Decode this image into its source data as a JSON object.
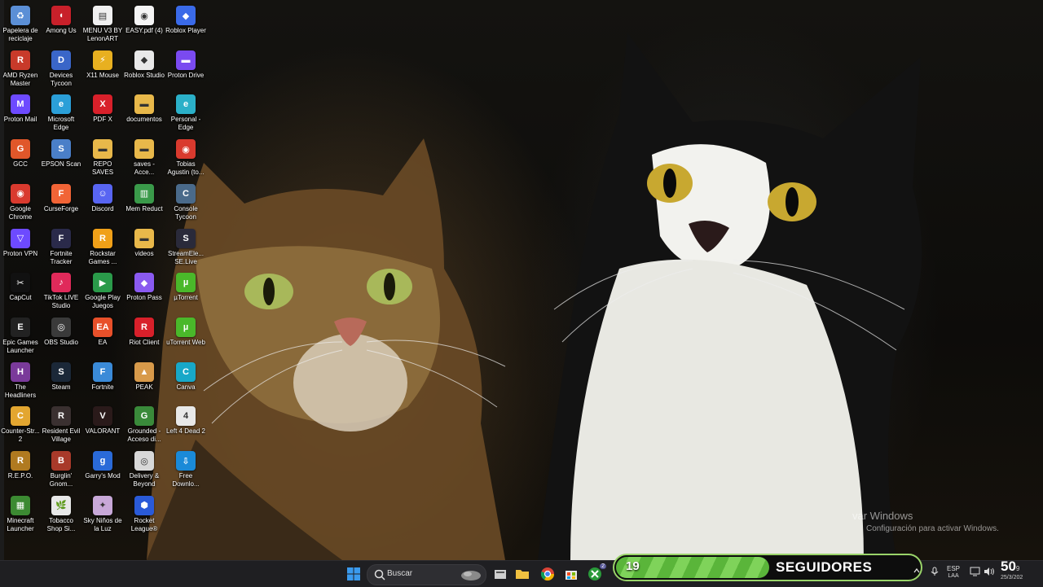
{
  "desktop": {
    "columns": [
      [
        {
          "label": "Papelera de reciclaje",
          "icon": "recycle-bin-icon",
          "color": "#5b8fd6",
          "glyph": "♻"
        },
        {
          "label": "AMD Ryzen Master",
          "icon": "amd-ryzen-icon",
          "color": "#c83a2a",
          "glyph": "R"
        },
        {
          "label": "Proton Mail",
          "icon": "proton-mail-icon",
          "color": "#6d4aff",
          "glyph": "M"
        },
        {
          "label": "GCC",
          "icon": "gcc-icon",
          "color": "#e0572a",
          "glyph": "G"
        },
        {
          "label": "Google Chrome",
          "icon": "chrome-icon",
          "color": "#d93a2e",
          "glyph": "◉"
        },
        {
          "label": "Proton VPN",
          "icon": "proton-vpn-icon",
          "color": "#6d4aff",
          "glyph": "▽"
        },
        {
          "label": "CapCut",
          "icon": "capcut-icon",
          "color": "#111111",
          "glyph": "✂"
        },
        {
          "label": "Epic Games Launcher",
          "icon": "epic-games-icon",
          "color": "#222222",
          "glyph": "E"
        },
        {
          "label": "The Headliners",
          "icon": "headliners-icon",
          "color": "#7a3a9a",
          "glyph": "H"
        },
        {
          "label": "Counter-Str... 2",
          "icon": "counter-strike-icon",
          "color": "#e3a630",
          "glyph": "C"
        },
        {
          "label": "R.E.P.O.",
          "icon": "repo-icon",
          "color": "#b07a20",
          "glyph": "R"
        },
        {
          "label": "Minecraft Launcher",
          "icon": "minecraft-icon",
          "color": "#3c8a32",
          "glyph": "▦"
        }
      ],
      [
        {
          "label": "Among Us",
          "icon": "among-us-icon",
          "color": "#c8202a",
          "glyph": "◖"
        },
        {
          "label": "Devices Tycoon",
          "icon": "devices-tycoon-icon",
          "color": "#3a66c8",
          "glyph": "D"
        },
        {
          "label": "Microsoft Edge",
          "icon": "edge-icon",
          "color": "#2b9fd8",
          "glyph": "e"
        },
        {
          "label": "EPSON Scan",
          "icon": "epson-scan-icon",
          "color": "#4a7fc8",
          "glyph": "S"
        },
        {
          "label": "CurseForge",
          "icon": "curseforge-icon",
          "color": "#f16436",
          "glyph": "F"
        },
        {
          "label": "Fortnite Tracker",
          "icon": "fortnite-tracker-icon",
          "color": "#2a2a4a",
          "glyph": "F"
        },
        {
          "label": "TikTok LIVE Studio",
          "icon": "tiktok-live-icon",
          "color": "#e02a5a",
          "glyph": "♪"
        },
        {
          "label": "OBS Studio",
          "icon": "obs-studio-icon",
          "color": "#3a3a3a",
          "glyph": "◎"
        },
        {
          "label": "Steam",
          "icon": "steam-icon",
          "color": "#1b2838",
          "glyph": "S"
        },
        {
          "label": "Resident Evil Village",
          "icon": "resident-evil-icon",
          "color": "#3a3030",
          "glyph": "R"
        },
        {
          "label": "Burglin' Gnom...",
          "icon": "burglin-gnomes-icon",
          "color": "#a83a2a",
          "glyph": "B"
        },
        {
          "label": "Tobacco Shop Si...",
          "icon": "tobacco-shop-icon",
          "color": "#e8e8e8",
          "glyph": "🌿"
        }
      ],
      [
        {
          "label": "MENU V3 BY LenonART",
          "icon": "menu-file-icon",
          "color": "#f0f0f0",
          "glyph": "▤"
        },
        {
          "label": "X11 Mouse",
          "icon": "x11-mouse-icon",
          "color": "#e8b020",
          "glyph": "⚡"
        },
        {
          "label": "PDF X",
          "icon": "pdf-x-icon",
          "color": "#d8202a",
          "glyph": "X"
        },
        {
          "label": "REPO SAVES",
          "icon": "folder-icon",
          "color": "#e8b84a",
          "glyph": "▬"
        },
        {
          "label": "Discord",
          "icon": "discord-icon",
          "color": "#5865f2",
          "glyph": "☺"
        },
        {
          "label": "Rockstar Games ...",
          "icon": "rockstar-icon",
          "color": "#f0a018",
          "glyph": "R"
        },
        {
          "label": "Google Play Juegos",
          "icon": "google-play-icon",
          "color": "#2a9a4a",
          "glyph": "▶"
        },
        {
          "label": "EA",
          "icon": "ea-icon",
          "color": "#e8502a",
          "glyph": "EA"
        },
        {
          "label": "Fortnite",
          "icon": "fortnite-icon",
          "color": "#3a8ad8",
          "glyph": "F"
        },
        {
          "label": "VALORANT",
          "icon": "valorant-icon",
          "color": "#2a1a1a",
          "glyph": "V"
        },
        {
          "label": "Garry's Mod",
          "icon": "garrys-mod-icon",
          "color": "#2a6ad8",
          "glyph": "g"
        },
        {
          "label": "Sky Niños de la Luz",
          "icon": "sky-icon",
          "color": "#c8a8d8",
          "glyph": "✦"
        }
      ],
      [
        {
          "label": "EASY.pdf (4)",
          "icon": "chrome-pdf-icon",
          "color": "#f4f4f4",
          "glyph": "◉"
        },
        {
          "label": "Roblox Studio",
          "icon": "roblox-studio-icon",
          "color": "#e8e8e8",
          "glyph": "◆"
        },
        {
          "label": "documentos",
          "icon": "folder-icon",
          "color": "#e8b84a",
          "glyph": "▬"
        },
        {
          "label": "saves - Acce...",
          "icon": "folder-shortcut-icon",
          "color": "#e8b84a",
          "glyph": "▬"
        },
        {
          "label": "Mem Reduct",
          "icon": "mem-reduct-icon",
          "color": "#3a9a4a",
          "glyph": "▥"
        },
        {
          "label": "videos",
          "icon": "folder-icon",
          "color": "#e8b84a",
          "glyph": "▬"
        },
        {
          "label": "Proton Pass",
          "icon": "proton-pass-icon",
          "color": "#8a5af0",
          "glyph": "◆"
        },
        {
          "label": "Riot Client",
          "icon": "riot-client-icon",
          "color": "#d8202a",
          "glyph": "R"
        },
        {
          "label": "PEAK",
          "icon": "peak-icon",
          "color": "#d89a4a",
          "glyph": "▲"
        },
        {
          "label": "Grounded - Acceso di...",
          "icon": "grounded-icon",
          "color": "#3a8a3a",
          "glyph": "G"
        },
        {
          "label": "Delivery & Beyond",
          "icon": "delivery-beyond-icon",
          "color": "#d8d8d8",
          "glyph": "◎"
        },
        {
          "label": "Rocket League®",
          "icon": "rocket-league-icon",
          "color": "#2a5ad8",
          "glyph": "⬢"
        }
      ],
      [
        {
          "label": "Roblox Player",
          "icon": "roblox-player-icon",
          "color": "#3a6ae8",
          "glyph": "◆"
        },
        {
          "label": "Proton Drive",
          "icon": "proton-drive-icon",
          "color": "#7a4af0",
          "glyph": "▬"
        },
        {
          "label": "Personal - Edge",
          "icon": "edge-profile-icon",
          "color": "#2bb0c8",
          "glyph": "e"
        },
        {
          "label": "Tobias Agustin (to...",
          "icon": "chrome-profile-icon",
          "color": "#d93a2e",
          "glyph": "◉"
        },
        {
          "label": "Console Tycoon",
          "icon": "console-tycoon-icon",
          "color": "#4a6a8a",
          "glyph": "C"
        },
        {
          "label": "StreamEle... SE.Live",
          "icon": "streamelements-icon",
          "color": "#2a2a3a",
          "glyph": "S"
        },
        {
          "label": "µTorrent",
          "icon": "utorrent-icon",
          "color": "#4ab82a",
          "glyph": "µ"
        },
        {
          "label": "uTorrent Web",
          "icon": "utorrent-web-icon",
          "color": "#4ab82a",
          "glyph": "µ"
        },
        {
          "label": "Canva",
          "icon": "canva-icon",
          "color": "#18a8c8",
          "glyph": "C"
        },
        {
          "label": "Left 4 Dead 2",
          "icon": "left4dead-icon",
          "color": "#e8e8e8",
          "glyph": "4"
        },
        {
          "label": "Free Downlo...",
          "icon": "free-download-icon",
          "color": "#1a8ad8",
          "glyph": "⇩"
        }
      ]
    ]
  },
  "activation": {
    "line1": "var Windows",
    "line2": "Configuración para activar Windows."
  },
  "taskbar": {
    "search_placeholder": "Buscar",
    "apps": [
      "file-explorer-icon",
      "folder-icon",
      "chrome-icon",
      "store-icon",
      "xbox-icon"
    ],
    "xbox_badge": "2"
  },
  "follower_banner": {
    "count": "19",
    "label": "SEGUIDORES"
  },
  "tray": {
    "lang_top": "ESP",
    "lang_bottom": "LAA",
    "clock_big": "50",
    "clock_small": "9",
    "date": "25/3/202"
  },
  "colors": {
    "taskbar": "#1f1f22",
    "banner_accent": "#5ab53a",
    "windows_blue": "#3a9aee"
  }
}
